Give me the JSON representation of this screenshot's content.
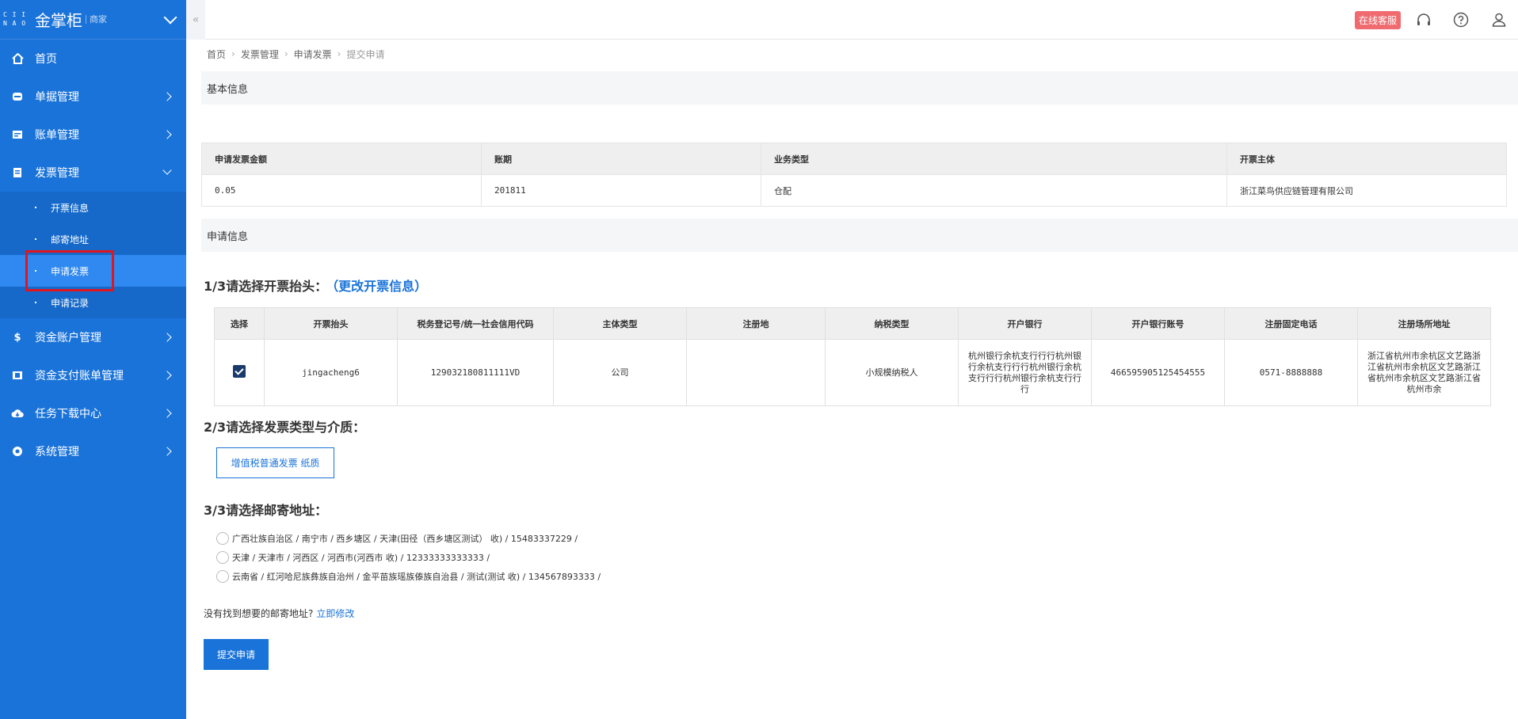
{
  "app": {
    "logo_mark": "CAINIAO",
    "title": "金掌柜",
    "subtitle": "商家"
  },
  "sidebar": {
    "items": [
      {
        "label": "首页",
        "icon": "home-icon"
      },
      {
        "label": "单据管理",
        "icon": "document-icon"
      },
      {
        "label": "账单管理",
        "icon": "bill-icon"
      },
      {
        "label": "发票管理",
        "icon": "invoice-icon"
      },
      {
        "label": "资金账户管理",
        "icon": "dollar-icon"
      },
      {
        "label": "资金支付账单管理",
        "icon": "payment-icon"
      },
      {
        "label": "任务下载中心",
        "icon": "cloud-download-icon"
      },
      {
        "label": "系统管理",
        "icon": "settings-icon"
      }
    ],
    "invoice_sub": [
      {
        "label": "开票信息"
      },
      {
        "label": "邮寄地址"
      },
      {
        "label": "申请发票"
      },
      {
        "label": "申请记录"
      }
    ]
  },
  "topbar": {
    "collapse_glyph": "«",
    "service_label": "在线客服"
  },
  "breadcrumb": [
    "首页",
    "发票管理",
    "申请发票",
    "提交申请"
  ],
  "basic_info": {
    "section_title": "基本信息",
    "columns": [
      "申请发票金额",
      "账期",
      "业务类型",
      "开票主体"
    ],
    "row": [
      "0.05",
      "201811",
      "仓配",
      "浙江菜鸟供应链管理有限公司"
    ]
  },
  "apply_info": {
    "section_title": "申请信息"
  },
  "step1": {
    "title": "1/3请选择开票抬头：",
    "link": "（更改开票信息）",
    "columns": [
      "选择",
      "开票抬头",
      "税务登记号/统一社会信用代码",
      "主体类型",
      "注册地",
      "纳税类型",
      "开户银行",
      "开户银行账号",
      "注册固定电话",
      "注册场所地址"
    ],
    "row": {
      "header": "jingacheng6",
      "tax_id": "129032180811111VD",
      "entity_type": "公司",
      "reg_place": "",
      "tax_type": "小规模纳税人",
      "bank": "杭州银行余杭支行行行杭州银行余杭支行行行杭州银行余杭支行行行杭州银行余杭支行行行",
      "account": "466595905125454555",
      "phone": "0571-8888888",
      "address": "浙江省杭州市余杭区文艺路浙江省杭州市余杭区文艺路浙江省杭州市余杭区文艺路浙江省杭州市余"
    }
  },
  "step2": {
    "title": "2/3请选择发票类型与介质：",
    "option": "增值税普通发票  纸质"
  },
  "step3": {
    "title": "3/3请选择邮寄地址：",
    "addresses": [
      "广西壮族自治区 / 南宁市 / 西乡塘区 / 天津(田径（西乡塘区测试） 收) / 15483337229 /",
      "天津 / 天津市 / 河西区 / 河西市(河西市 收) / 12333333333333 /",
      "云南省 / 红河哈尼族彝族自治州 / 金平苗族瑶族傣族自治县 / 测试(测试 收) / 134567893333 /"
    ],
    "hint": "没有找到想要的邮寄地址?",
    "hint_link": "立即修改"
  },
  "submit_label": "提交申请",
  "colors": {
    "sidebar": "#1a73d9",
    "accent": "#1a73d9",
    "badge": "#f06b6f",
    "highlight": "#e0151f"
  }
}
